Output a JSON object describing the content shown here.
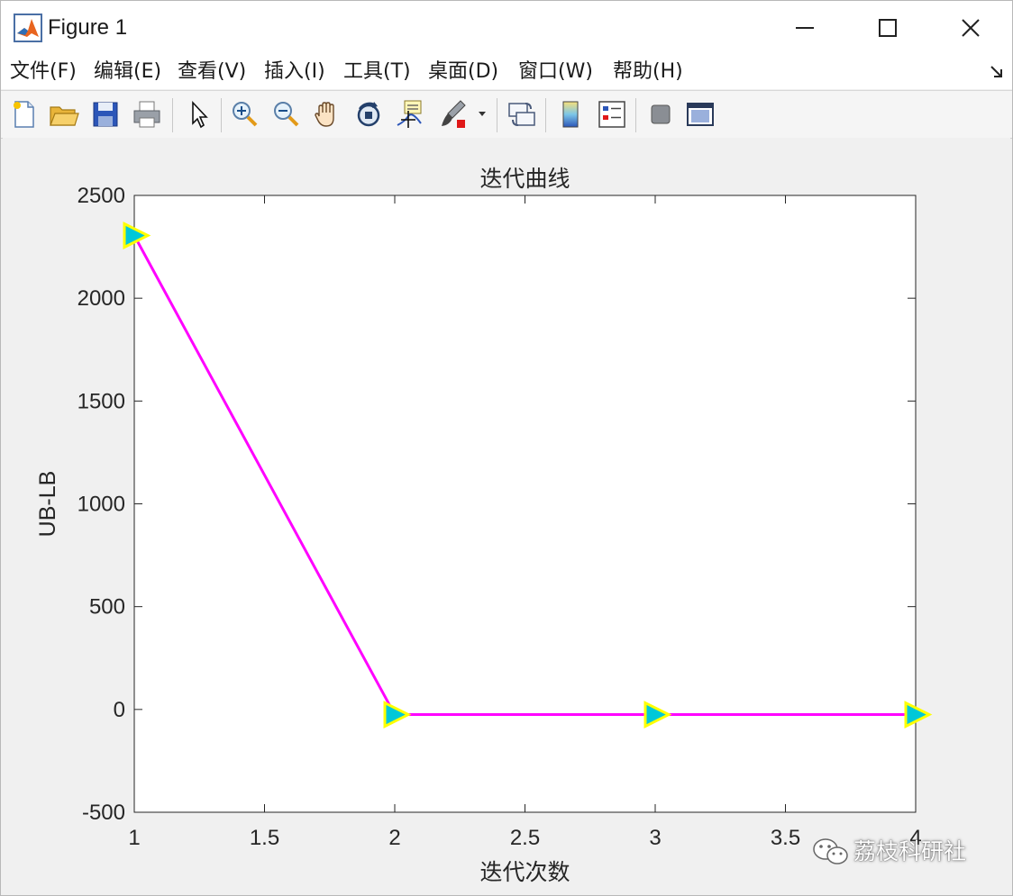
{
  "window": {
    "title": "Figure 1"
  },
  "menu": [
    "文件(F)",
    "编辑(E)",
    "查看(V)",
    "插入(I)",
    "工具(T)",
    "桌面(D)",
    "窗口(W)",
    "帮助(H)"
  ],
  "toolbar": [
    "new-figure-icon",
    "open-folder-icon",
    "save-icon",
    "print-icon",
    "pointer-icon",
    "zoom-in-icon",
    "zoom-out-icon",
    "pan-hand-icon",
    "rotate-3d-icon",
    "data-cursor-icon",
    "brush-icon",
    "link-plot-icon",
    "colorbar-icon",
    "legend-icon",
    "hide-plot-tools-icon",
    "show-plot-tools-icon"
  ],
  "chart_data": {
    "type": "line",
    "title": "迭代曲线",
    "xlabel": "迭代次数",
    "ylabel": "UB-LB",
    "x": [
      1,
      2,
      3,
      4
    ],
    "series": [
      {
        "values": [
          2305,
          -25,
          -25,
          -25
        ],
        "color": "#ff00ff",
        "marker": "triangle-right",
        "marker_face": "#00c8d8",
        "marker_edge": "#ffff00"
      }
    ],
    "xlim": [
      1,
      4
    ],
    "ylim": [
      -500,
      2500
    ],
    "xticks": [
      1,
      1.5,
      2,
      2.5,
      3,
      3.5,
      4
    ],
    "xtick_labels": [
      "1",
      "1.5",
      "2",
      "2.5",
      "3",
      "3.5",
      "4"
    ],
    "yticks": [
      -500,
      0,
      500,
      1000,
      1500,
      2000,
      2500
    ],
    "ytick_labels": [
      "-500",
      "0",
      "500",
      "1000",
      "1500",
      "2000",
      "2500"
    ],
    "grid": false
  },
  "watermark": {
    "text": "荔枝科研社"
  }
}
